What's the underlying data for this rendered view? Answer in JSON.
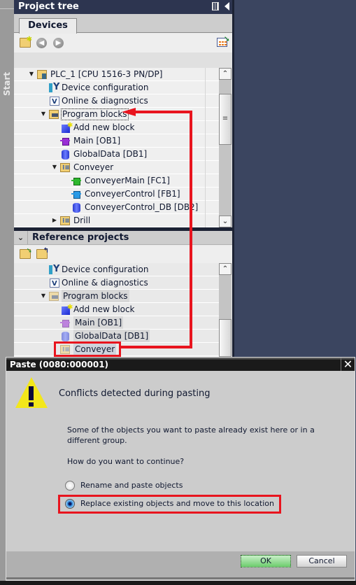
{
  "left_strip": {
    "label": "Start"
  },
  "panel": {
    "title": "Project tree",
    "tab": "Devices",
    "toolbar_icons": [
      "add-folder-icon",
      "back-icon",
      "forward-icon",
      "table-view-icon"
    ]
  },
  "tree": {
    "items": [
      {
        "label": "PLC_1 [CPU 1516-3 PN/DP]",
        "icon": "plc-icon",
        "expander": "▼",
        "level": 0
      },
      {
        "label": "Device configuration",
        "icon": "device-config-icon",
        "expander": "",
        "level": 1
      },
      {
        "label": "Online & diagnostics",
        "icon": "online-diagnostics-icon",
        "expander": "",
        "level": 1
      },
      {
        "label": "Program blocks",
        "icon": "program-blocks-folder-icon",
        "expander": "▼",
        "level": 1,
        "focused": true
      },
      {
        "label": "Add new block",
        "icon": "add-block-icon",
        "expander": "",
        "level": 2
      },
      {
        "label": "Main [OB1]",
        "icon": "ob-icon",
        "expander": "",
        "level": 2
      },
      {
        "label": "GlobalData [DB1]",
        "icon": "db-icon",
        "expander": "",
        "level": 2
      },
      {
        "label": "Conveyer",
        "icon": "group-folder-icon",
        "expander": "▼",
        "level": 2
      },
      {
        "label": "ConveyerMain [FC1]",
        "icon": "fc-icon",
        "expander": "",
        "level": 3
      },
      {
        "label": "ConveyerControl [FB1]",
        "icon": "fb-icon",
        "expander": "",
        "level": 3
      },
      {
        "label": "ConveyerControl_DB [DB2]",
        "icon": "db-icon",
        "expander": "",
        "level": 3
      },
      {
        "label": "Drill",
        "icon": "group-folder-icon",
        "expander": "▶",
        "level": 2
      }
    ]
  },
  "reference": {
    "title": "Reference projects",
    "chevron": "⌄",
    "toolbar_icons": [
      "open-reference-icon",
      "close-reference-icon"
    ],
    "items": [
      {
        "label": "Device configuration",
        "icon": "device-config-icon",
        "expander": ""
      },
      {
        "label": "Online & diagnostics",
        "icon": "online-diagnostics-icon",
        "expander": ""
      },
      {
        "label": "Program blocks",
        "icon": "program-blocks-folder-icon",
        "expander": "▼"
      },
      {
        "label": "Add new block",
        "icon": "add-block-icon",
        "expander": ""
      },
      {
        "label": "Main [OB1]",
        "icon": "ob-icon",
        "expander": ""
      },
      {
        "label": "GlobalData [DB1]",
        "icon": "db-icon",
        "expander": ""
      },
      {
        "label": "Conveyer",
        "icon": "group-folder-icon",
        "expander": ""
      }
    ]
  },
  "annotation": {
    "color": "#e8141e"
  },
  "dialog": {
    "title": "Paste (0080:000001)",
    "close": "✕",
    "heading": "Conflicts detected during pasting",
    "message": "Some of the objects you want to paste already exist here or in a different group.",
    "question": "How do you want to continue?",
    "options": [
      {
        "label": "Rename and paste objects",
        "selected": false
      },
      {
        "label": "Replace existing objects and move to this location",
        "selected": true
      }
    ],
    "ok_label": "OK",
    "cancel_label": "Cancel"
  },
  "scroll": {
    "up": "⌃",
    "down": "⌄",
    "grip": "≡"
  }
}
